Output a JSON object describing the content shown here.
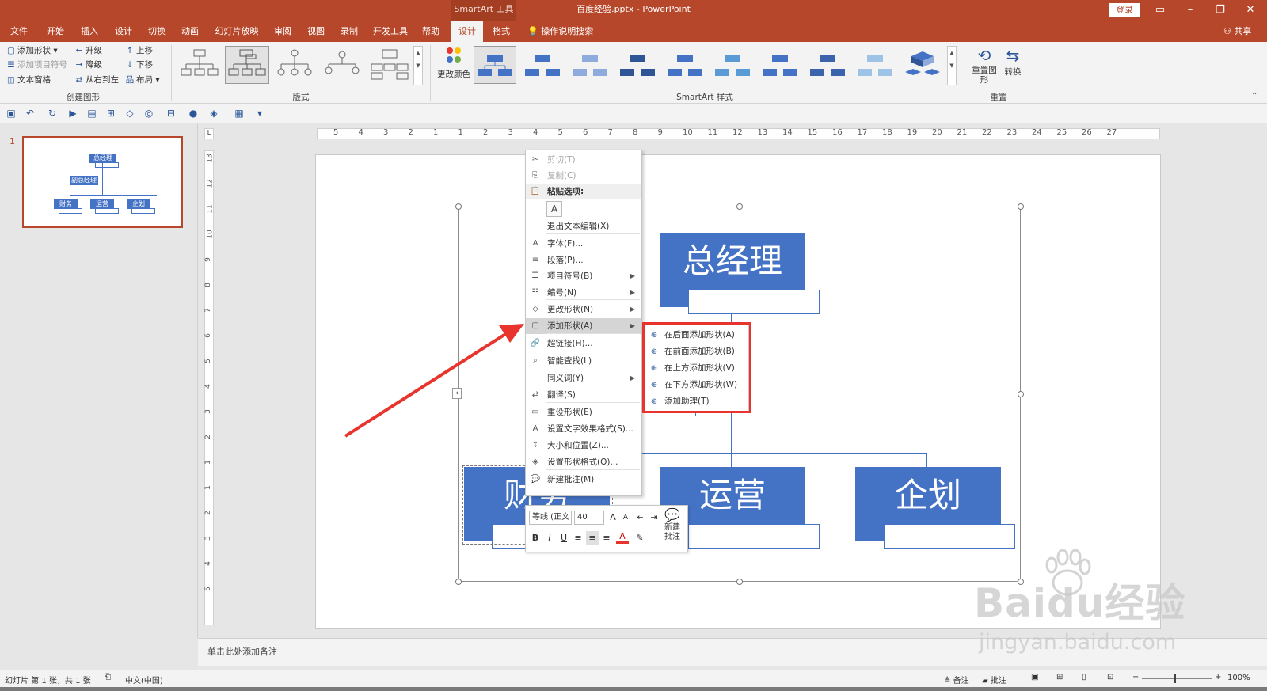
{
  "window": {
    "context_group": "SmartArt 工具",
    "doc_title": "百度经验.pptx  -  PowerPoint",
    "login": "登录",
    "share": "共享"
  },
  "tabs": [
    "文件",
    "开始",
    "插入",
    "设计",
    "切换",
    "动画",
    "幻灯片放映",
    "审阅",
    "视图",
    "录制",
    "开发工具",
    "帮助",
    "设计",
    "格式"
  ],
  "active_tab_index": 12,
  "search_hint": "操作说明搜索",
  "ribbon": {
    "create_group": {
      "label": "创建图形",
      "add_shape": "添加形状",
      "add_bullet": "添加项目符号",
      "text_pane": "文本窗格",
      "promote": "升级",
      "demote": "降级",
      "rtl": "从右到左",
      "move_up": "上移",
      "move_down": "下移",
      "layout": "布局"
    },
    "layouts_label": "版式",
    "change_colors": "更改颜色",
    "styles_label": "SmartArt 样式",
    "reset_group": {
      "label": "重置",
      "reset_graphic": "重置图形",
      "convert": "转换"
    }
  },
  "slide_panel": {
    "slide_number": "1",
    "thumb": {
      "top": "总经理",
      "assistant": "副总经理",
      "children": [
        "财务",
        "运营",
        "企划"
      ]
    }
  },
  "ruler": {
    "h_labels": [
      "5",
      "4",
      "3",
      "2",
      "1",
      "1",
      "2",
      "3",
      "4",
      "5",
      "6",
      "7",
      "8",
      "9",
      "10",
      "11",
      "12",
      "13",
      "14",
      "15",
      "16",
      "17",
      "18",
      "19",
      "20",
      "21",
      "22",
      "23",
      "24",
      "25",
      "26",
      "27"
    ],
    "v_labels": [
      "13",
      "12",
      "11",
      "10",
      "9",
      "8",
      "7",
      "6",
      "5",
      "4",
      "3",
      "2",
      "1",
      "1",
      "2",
      "3",
      "4",
      "5"
    ]
  },
  "smartart": {
    "top": "总经理",
    "children": [
      "财务",
      "运营",
      "企划"
    ]
  },
  "context_menu": {
    "items": [
      {
        "icon": "✂",
        "label": "剪切(T)",
        "disabled": true
      },
      {
        "icon": "⎘",
        "label": "复制(C)",
        "disabled": true
      },
      {
        "icon": "📋",
        "label": "粘贴选项:",
        "header": true
      },
      {
        "icon": "",
        "label": "退出文本编辑(X)"
      },
      {
        "icon": "A",
        "label": "字体(F)..."
      },
      {
        "icon": "≡",
        "label": "段落(P)..."
      },
      {
        "icon": "☰",
        "label": "项目符号(B)",
        "submenu": true
      },
      {
        "icon": "☷",
        "label": "编号(N)",
        "submenu": true
      },
      {
        "icon": "◇",
        "label": "更改形状(N)",
        "submenu": true
      },
      {
        "icon": "▢",
        "label": "添加形状(A)",
        "submenu": true,
        "highlight": true
      },
      {
        "icon": "🔗",
        "label": "超链接(H)..."
      },
      {
        "icon": "⌕",
        "label": "智能查找(L)"
      },
      {
        "icon": "",
        "label": "同义词(Y)",
        "submenu": true
      },
      {
        "icon": "⇄",
        "label": "翻译(S)"
      },
      {
        "icon": "▭",
        "label": "重设形状(E)"
      },
      {
        "icon": "A",
        "label": "设置文字效果格式(S)..."
      },
      {
        "icon": "↕",
        "label": "大小和位置(Z)..."
      },
      {
        "icon": "◈",
        "label": "设置形状格式(O)..."
      },
      {
        "icon": "💬",
        "label": "新建批注(M)"
      }
    ]
  },
  "submenu": {
    "items": [
      "在后面添加形状(A)",
      "在前面添加形状(B)",
      "在上方添加形状(V)",
      "在下方添加形状(W)",
      "添加助理(T)"
    ]
  },
  "mini_toolbar": {
    "font": "等线 (正文",
    "size": "40",
    "new_comment": "新建批注"
  },
  "notes_placeholder": "单击此处添加备注",
  "status": {
    "slide_info": "幻灯片 第 1 张，共 1 张",
    "language": "中文(中国)",
    "notes": "备注",
    "comments": "批注",
    "zoom": "100%"
  },
  "watermark": {
    "brand": "Baidu经验",
    "url": "jingyan.baidu.com"
  },
  "colors": {
    "accent": "#b7472a",
    "smartart_blue": "#4472c4",
    "highlight_red": "#e8342d"
  }
}
